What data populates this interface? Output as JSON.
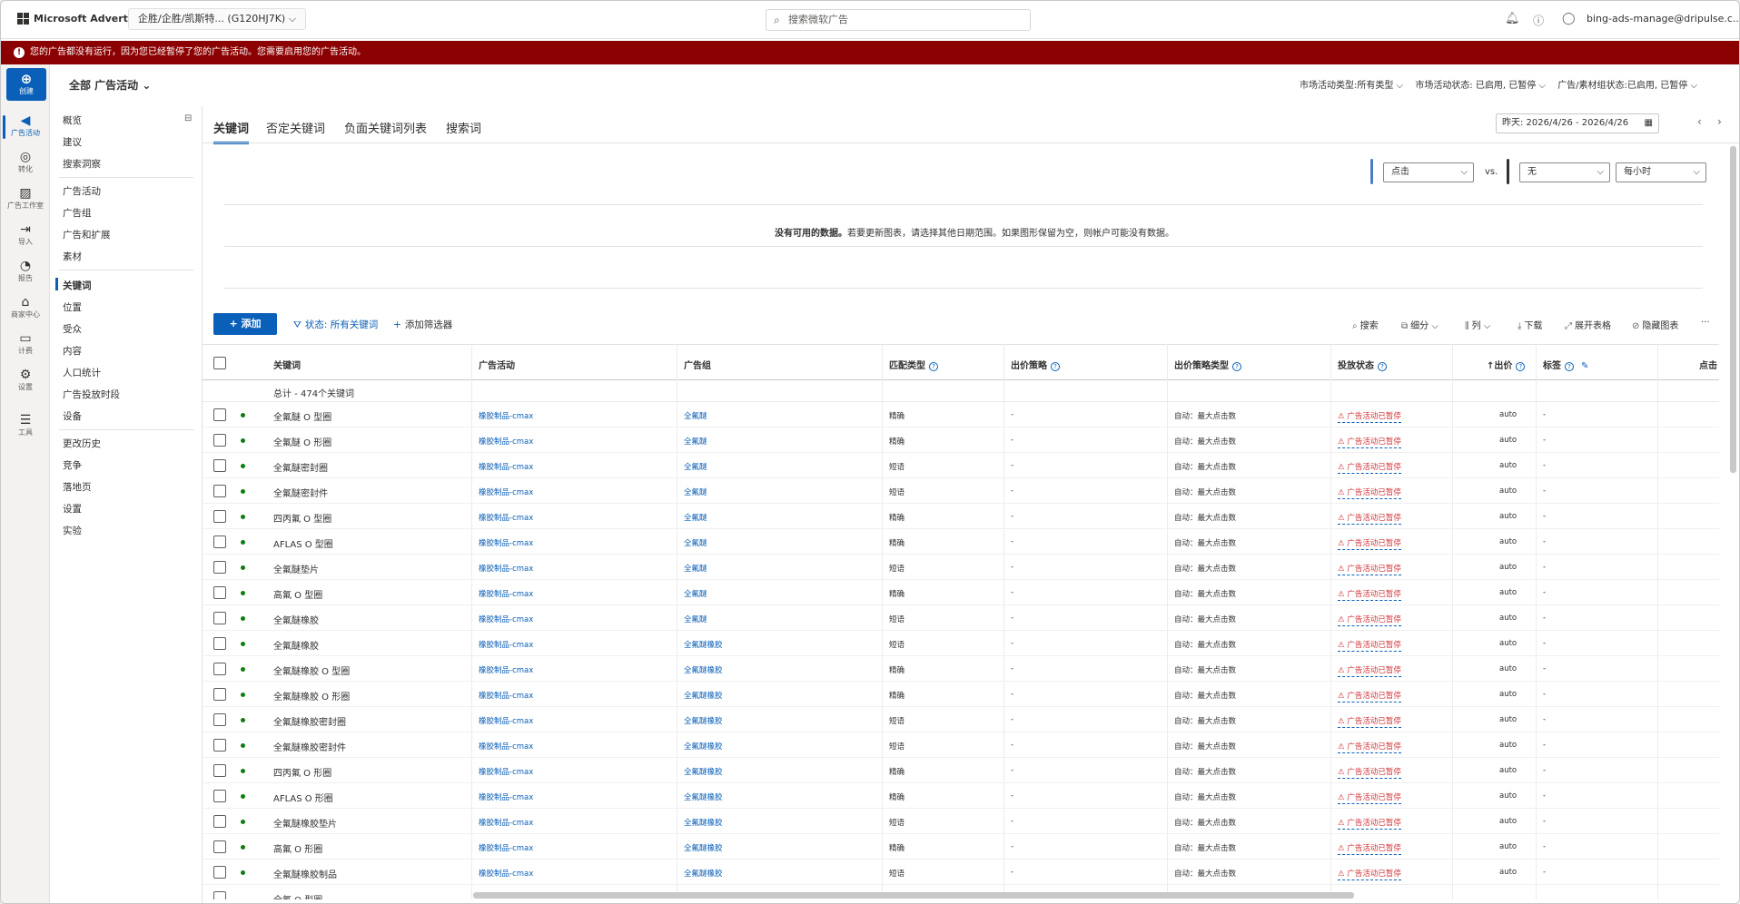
{
  "topbar": {
    "brand": "Microsoft Advertising",
    "account": "企胜/企胜/凯斯特... (G120HJ7K) ⌵",
    "search_placeholder": "搜索微软广告",
    "user": "bing-ads-manage@dripulse.c..."
  },
  "banner": {
    "text": "您的广告都没有运行，因为您已经暂停了您的广告活动。您需要启用您的广告活动。"
  },
  "rail": {
    "create": "创建",
    "items": [
      "广告活动",
      "转化",
      "广告工作室",
      "导入",
      "报告",
      "商家中心",
      "计费",
      "设置",
      "工具"
    ]
  },
  "scope": {
    "label": "全部 广告活动 ⌄"
  },
  "filters": {
    "f1": "市场活动类型:所有类型 ⌵",
    "f2": "市场活动状态: 已启用, 已暂停 ⌵",
    "f3": "广告/素材组状态:已启用, 已暂停 ⌵"
  },
  "nav": {
    "g1": [
      "概览",
      "建议",
      "搜索洞察"
    ],
    "g2": [
      "广告活动",
      "广告组",
      "广告和扩展",
      "素材"
    ],
    "g3": [
      "关键词",
      "位置",
      "受众",
      "内容",
      "人口统计",
      "广告投放时段",
      "设备"
    ],
    "g4": [
      "更改历史",
      "竞争",
      "落地页",
      "设置",
      "实验"
    ]
  },
  "tabs": [
    "关键词",
    "否定关键词",
    "负面关键词列表",
    "搜索词"
  ],
  "date_range": "昨天: 2026/4/26 - 2026/4/26",
  "chart": {
    "metric1": "点击",
    "vs": "vs.",
    "metric2": "无",
    "granularity": "每小时",
    "nodata_bold": "没有可用的数据。",
    "nodata_text": "若要更新图表，请选择其他日期范围。如果图形保留为空，则帐户可能没有数据。",
    "color1": "#4a7fc1",
    "color2": "#323130"
  },
  "toolbar": {
    "add": "+ 添加",
    "status_filter": "状态: 所有关键词",
    "add_filter": "添加筛选器",
    "search": "搜索",
    "segment": "细分 ⌵",
    "columns": "列 ⌵",
    "download": "下载",
    "expand": "展开表格",
    "hide_chart": "隐藏图表",
    "more": "···"
  },
  "table": {
    "headers": [
      "关键词",
      "广告活动",
      "广告组",
      "匹配类型",
      "出价策略",
      "出价策略类型",
      "投放状态",
      "出价",
      "标签",
      "点击"
    ],
    "total": "总计 - 474个关键词",
    "rows": [
      [
        "全氟醚 O 型圈",
        "橡胶制品-cmax",
        "全氟醚",
        "精确",
        "-",
        "自动：最大点击数",
        "广告活动已暂停",
        "auto",
        "-"
      ],
      [
        "全氟醚 O 形圈",
        "橡胶制品-cmax",
        "全氟醚",
        "精确",
        "-",
        "自动：最大点击数",
        "广告活动已暂停",
        "auto",
        "-"
      ],
      [
        "全氟醚密封圈",
        "橡胶制品-cmax",
        "全氟醚",
        "短语",
        "-",
        "自动：最大点击数",
        "广告活动已暂停",
        "auto",
        "-"
      ],
      [
        "全氟醚密封件",
        "橡胶制品-cmax",
        "全氟醚",
        "短语",
        "-",
        "自动：最大点击数",
        "广告活动已暂停",
        "auto",
        "-"
      ],
      [
        "四丙氟 O 型圈",
        "橡胶制品-cmax",
        "全氟醚",
        "精确",
        "-",
        "自动：最大点击数",
        "广告活动已暂停",
        "auto",
        "-"
      ],
      [
        "AFLAS O 型圈",
        "橡胶制品-cmax",
        "全氟醚",
        "精确",
        "-",
        "自动：最大点击数",
        "广告活动已暂停",
        "auto",
        "-"
      ],
      [
        "全氟醚垫片",
        "橡胶制品-cmax",
        "全氟醚",
        "短语",
        "-",
        "自动：最大点击数",
        "广告活动已暂停",
        "auto",
        "-"
      ],
      [
        "高氟 O 型圈",
        "橡胶制品-cmax",
        "全氟醚",
        "精确",
        "-",
        "自动：最大点击数",
        "广告活动已暂停",
        "auto",
        "-"
      ],
      [
        "全氟醚橡胶",
        "橡胶制品-cmax",
        "全氟醚",
        "短语",
        "-",
        "自动：最大点击数",
        "广告活动已暂停",
        "auto",
        "-"
      ],
      [
        "全氟醚橡胶",
        "橡胶制品-cmax",
        "全氟醚橡胶",
        "短语",
        "-",
        "自动：最大点击数",
        "广告活动已暂停",
        "auto",
        "-"
      ],
      [
        "全氟醚橡胶 O 型圈",
        "橡胶制品-cmax",
        "全氟醚橡胶",
        "精确",
        "-",
        "自动：最大点击数",
        "广告活动已暂停",
        "auto",
        "-"
      ],
      [
        "全氟醚橡胶 O 形圈",
        "橡胶制品-cmax",
        "全氟醚橡胶",
        "精确",
        "-",
        "自动：最大点击数",
        "广告活动已暂停",
        "auto",
        "-"
      ],
      [
        "全氟醚橡胶密封圈",
        "橡胶制品-cmax",
        "全氟醚橡胶",
        "短语",
        "-",
        "自动：最大点击数",
        "广告活动已暂停",
        "auto",
        "-"
      ],
      [
        "全氟醚橡胶密封件",
        "橡胶制品-cmax",
        "全氟醚橡胶",
        "短语",
        "-",
        "自动：最大点击数",
        "广告活动已暂停",
        "auto",
        "-"
      ],
      [
        "四丙氟 O 形圈",
        "橡胶制品-cmax",
        "全氟醚橡胶",
        "精确",
        "-",
        "自动：最大点击数",
        "广告活动已暂停",
        "auto",
        "-"
      ],
      [
        "AFLAS O 形圈",
        "橡胶制品-cmax",
        "全氟醚橡胶",
        "精确",
        "-",
        "自动：最大点击数",
        "广告活动已暂停",
        "auto",
        "-"
      ],
      [
        "全氟醚橡胶垫片",
        "橡胶制品-cmax",
        "全氟醚橡胶",
        "短语",
        "-",
        "自动：最大点击数",
        "广告活动已暂停",
        "auto",
        "-"
      ],
      [
        "高氟 O 形圈",
        "橡胶制品-cmax",
        "全氟醚橡胶",
        "精确",
        "-",
        "自动：最大点击数",
        "广告活动已暂停",
        "auto",
        "-"
      ],
      [
        "全氟醚橡胶制品",
        "橡胶制品-cmax",
        "全氟醚橡胶",
        "短语",
        "-",
        "自动：最大点击数",
        "广告活动已暂停",
        "auto",
        "-"
      ],
      [
        "全氟 O 型圈",
        "",
        "",
        "",
        "",
        "",
        "",
        "",
        ""
      ]
    ]
  }
}
